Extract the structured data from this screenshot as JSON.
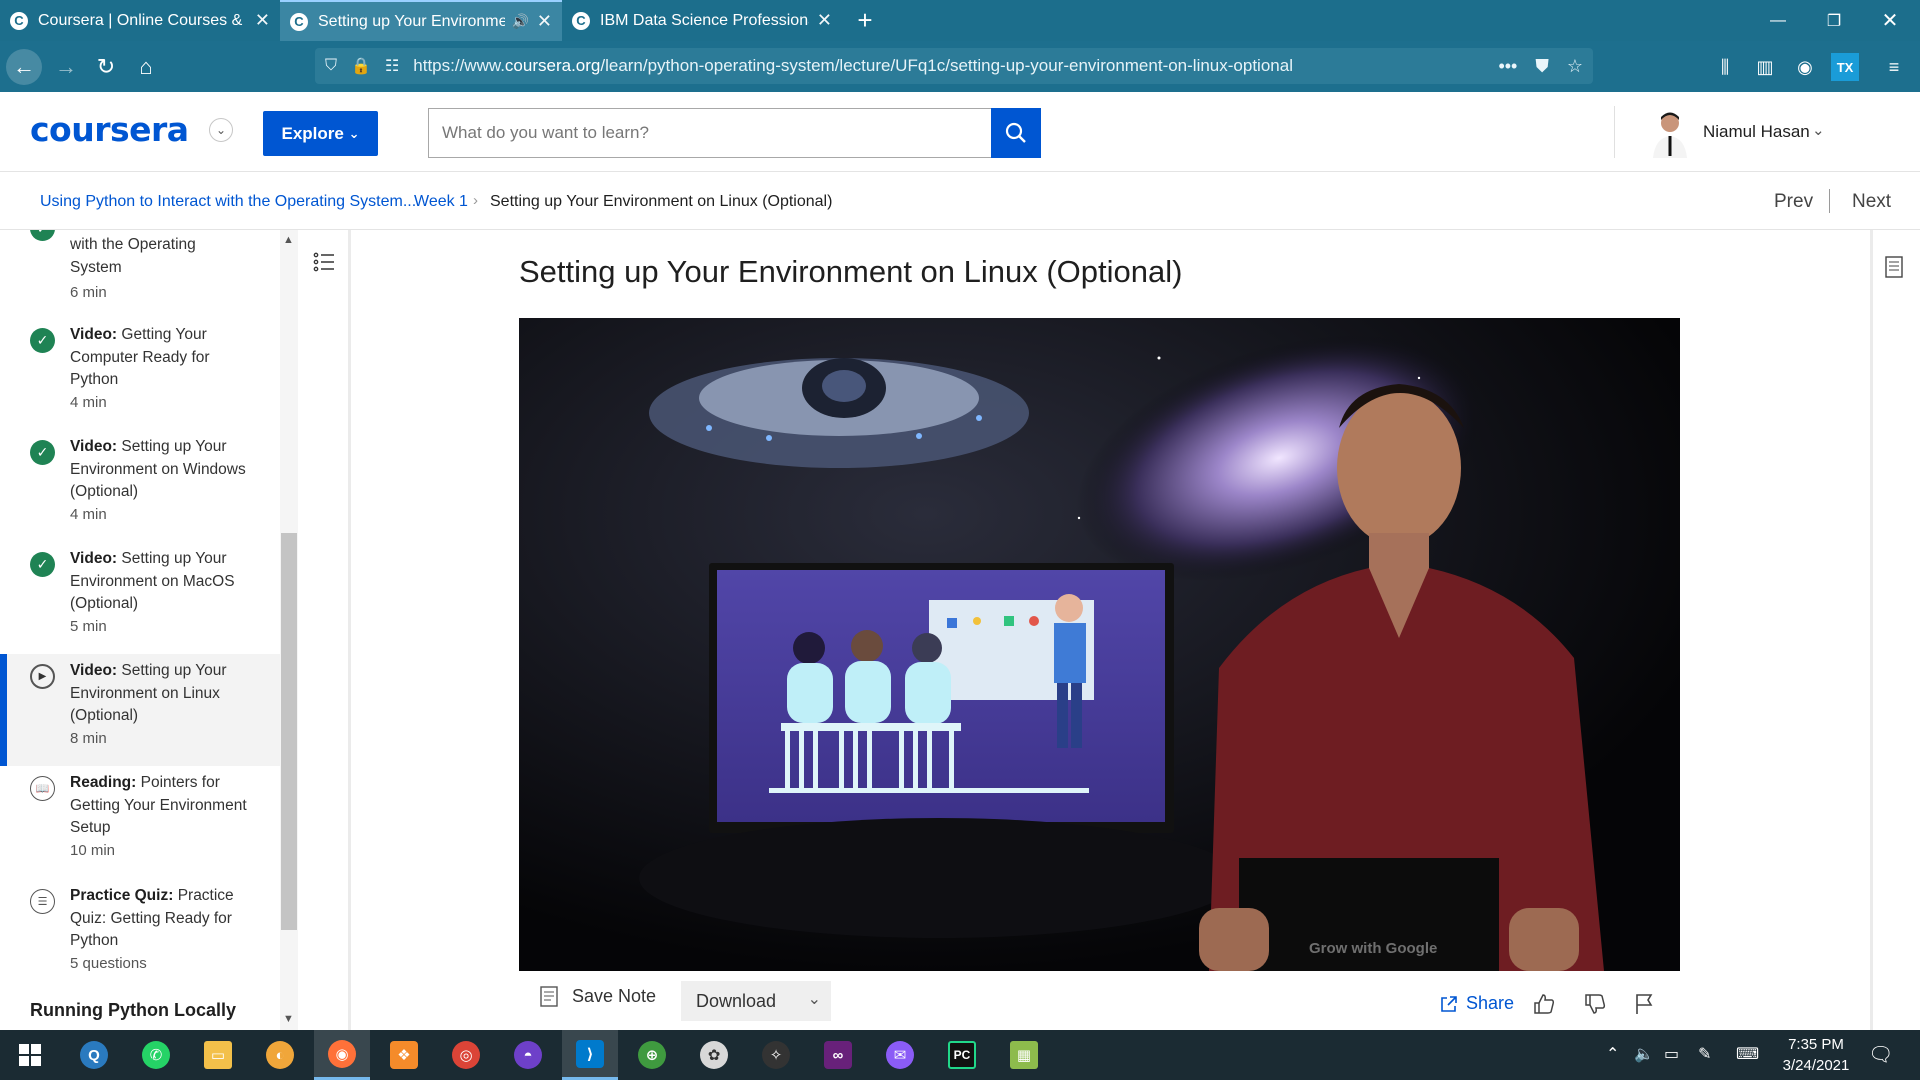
{
  "browser": {
    "tabs": [
      {
        "title": "Coursera | Online Courses & Cr",
        "active": false
      },
      {
        "title": "Setting up Your Environmen",
        "active": true
      },
      {
        "title": "IBM Data Science Professional",
        "active": false
      }
    ],
    "url_prefix": "https://www.",
    "url_domain": "coursera.org",
    "url_path": "/learn/python-operating-system/lecture/UFq1c/setting-up-your-environment-on-linux-optional"
  },
  "header": {
    "logo": "coursera",
    "explore_label": "Explore",
    "search_placeholder": "What do you want to learn?",
    "user_name": "Niamul Hasan"
  },
  "breadcrumb": {
    "course": "Using Python to Interact with the Operating System...",
    "week": "Week 1",
    "current": "Setting up Your Environment on Linux (Optional)",
    "prev": "Prev",
    "next": "Next"
  },
  "sidebar": {
    "items": [
      {
        "kind": "",
        "text": "with the Operating System",
        "duration": "6 min",
        "status": "done"
      },
      {
        "kind": "Video:",
        "text": "Getting Your Computer Ready for Python",
        "duration": "4 min",
        "status": "done"
      },
      {
        "kind": "Video:",
        "text": "Setting up Your Environment on Windows (Optional)",
        "duration": "4 min",
        "status": "done"
      },
      {
        "kind": "Video:",
        "text": "Setting up Your Environment on MacOS (Optional)",
        "duration": "5 min",
        "status": "done"
      },
      {
        "kind": "Video:",
        "text": "Setting up Your Environment on Linux (Optional)",
        "duration": "8 min",
        "status": "current"
      },
      {
        "kind": "Reading:",
        "text": "Pointers for Getting Your Environment Setup",
        "duration": "10 min",
        "status": "reading"
      },
      {
        "kind": "Practice Quiz:",
        "text": "Practice Quiz: Getting Ready for Python",
        "duration": "5 questions",
        "status": "quiz"
      }
    ],
    "section_title": "Running Python Locally"
  },
  "main": {
    "title": "Setting up Your Environment on Linux (Optional)",
    "video_watermark": "Grow with Google",
    "save_note": "Save Note",
    "download": "Download",
    "share": "Share"
  },
  "taskbar": {
    "time": "7:35 PM",
    "date": "3/24/2021"
  },
  "colors": {
    "brand": "#0056d2",
    "browser_chrome": "#1c6e8c",
    "complete": "#1f8354",
    "taskbar": "#1b2b33"
  }
}
